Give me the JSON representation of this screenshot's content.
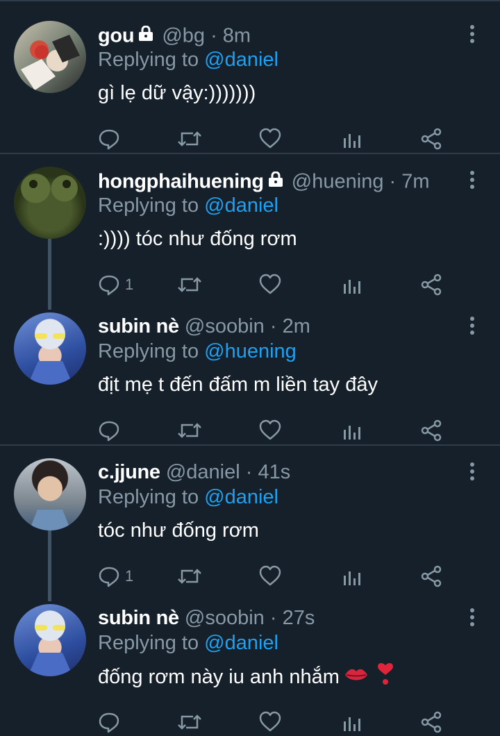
{
  "tweets": [
    {
      "name": "gou",
      "locked": true,
      "handle": "@bg · 8m",
      "replying_prefix": "Replying to ",
      "replying_to": "@daniel",
      "text": "gì lẹ dữ vậy:)))))))",
      "reply_count": ""
    },
    {
      "name": "hongphaihuening",
      "locked": true,
      "handle": "@huening · 7m",
      "replying_prefix": "Replying to ",
      "replying_to": "@daniel",
      "text": ":)))) tóc như đống rơm",
      "reply_count": "1"
    },
    {
      "name": "subin nè",
      "locked": false,
      "handle": "@soobin · 2m",
      "replying_prefix": "Replying to ",
      "replying_to": "@huening",
      "text": "địt mẹ t đến đấm m liền tay đây",
      "reply_count": ""
    },
    {
      "name": "c.jjune",
      "locked": false,
      "handle": "@daniel · 41s",
      "replying_prefix": "Replying to ",
      "replying_to": "@daniel",
      "text": "tóc như đống rơm",
      "reply_count": "1"
    },
    {
      "name": "subin nè",
      "locked": false,
      "handle": "@soobin · 27s",
      "replying_prefix": "Replying to ",
      "replying_to": "@daniel",
      "text": "đống rơm này iu anh nhắm",
      "reply_count": ""
    }
  ],
  "icons": {
    "reply": "reply-icon",
    "retweet": "retweet-icon",
    "like": "heart-icon",
    "analytics": "analytics-icon",
    "share": "share-icon",
    "more": "more-vertical-icon",
    "lock": "lock-icon"
  },
  "colors": {
    "background": "#15202b",
    "secondary_text": "#8899a6",
    "accent": "#1da1f2",
    "divider": "#2f3d4a"
  }
}
